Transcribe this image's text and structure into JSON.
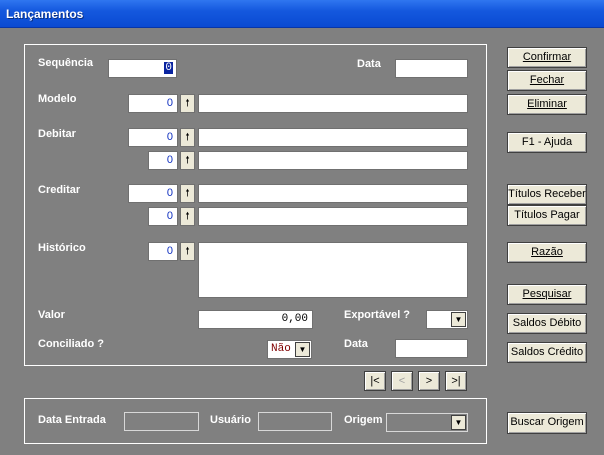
{
  "window": {
    "title": "Lançamentos"
  },
  "form": {
    "sequencia": {
      "label": "Sequência",
      "value": "0"
    },
    "data": {
      "label": "Data",
      "value": ""
    },
    "modelo": {
      "label": "Modelo",
      "code": "0",
      "desc": ""
    },
    "debitar": {
      "label": "Debitar",
      "code1": "0",
      "desc1": "",
      "code2": "0",
      "desc2": ""
    },
    "creditar": {
      "label": "Creditar",
      "code1": "0",
      "desc1": "",
      "code2": "0",
      "desc2": ""
    },
    "historico": {
      "label": "Histórico",
      "code": "0",
      "text": ""
    },
    "valor": {
      "label": "Valor",
      "value": "0,00"
    },
    "exportavel": {
      "label": "Exportável ?",
      "value": ""
    },
    "conciliado": {
      "label": "Conciliado ?",
      "value": "Não"
    },
    "data2": {
      "label": "Data",
      "value": ""
    },
    "arrow_glyph": "🠕"
  },
  "nav": {
    "first": "|<",
    "prev": "<",
    "next": ">",
    "last": ">|"
  },
  "bottom": {
    "data_entrada": {
      "label": "Data Entrada",
      "value": ""
    },
    "usuario": {
      "label": "Usuário",
      "value": ""
    },
    "origem": {
      "label": "Origem",
      "value": ""
    }
  },
  "buttons": {
    "confirmar": "Confirmar",
    "fechar": "Fechar",
    "eliminar": "Eliminar",
    "ajuda": "F1 - Ajuda",
    "titulos_receber": "Títulos Receber",
    "titulos_pagar": "Títulos Pagar",
    "razao": "Razão",
    "pesquisar": "Pesquisar",
    "saldos_debito": "Saldos Débito",
    "saldos_credito": "Saldos Crédito",
    "buscar_origem": "Buscar Origem"
  },
  "colors": {
    "background": "#808080",
    "titlebar": "#1458de",
    "button_face": "#ece9d8"
  }
}
